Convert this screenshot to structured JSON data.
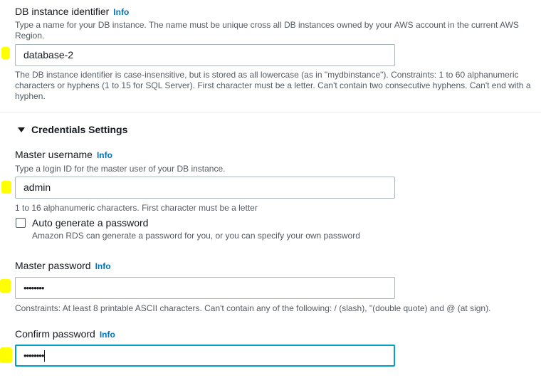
{
  "db_identifier": {
    "label": "DB instance identifier",
    "info": "Info",
    "description": "Type a name for your DB instance. The name must be unique cross all DB instances owned by your AWS account in the current AWS Region.",
    "value": "database-2",
    "constraints": "The DB instance identifier is case-insensitive, but is stored as all lowercase (as in \"mydbinstance\"). Constraints: 1 to 60 alphanumeric characters or hyphens (1 to 15 for SQL Server). First character must be a letter. Can't contain two consecutive hyphens. Can't end with a hyphen."
  },
  "credentials": {
    "section_title": "Credentials Settings",
    "master_username": {
      "label": "Master username",
      "info": "Info",
      "description": "Type a login ID for the master user of your DB instance.",
      "value": "admin",
      "constraints": "1 to 16 alphanumeric characters. First character must be a letter"
    },
    "auto_generate": {
      "label": "Auto generate a password",
      "description": "Amazon RDS can generate a password for you, or you can specify your own password",
      "checked": false
    },
    "master_password": {
      "label": "Master password",
      "info": "Info",
      "value": "••••••••",
      "constraints": "Constraints: At least 8 printable ASCII characters. Can't contain any of the following: / (slash), \"(double quote) and @ (at sign)."
    },
    "confirm_password": {
      "label": "Confirm password",
      "info": "Info",
      "value": "••••••••"
    }
  },
  "colors": {
    "link": "#0073bb",
    "focus_border": "#00a1c9",
    "highlight_marker": "#ffff00"
  }
}
